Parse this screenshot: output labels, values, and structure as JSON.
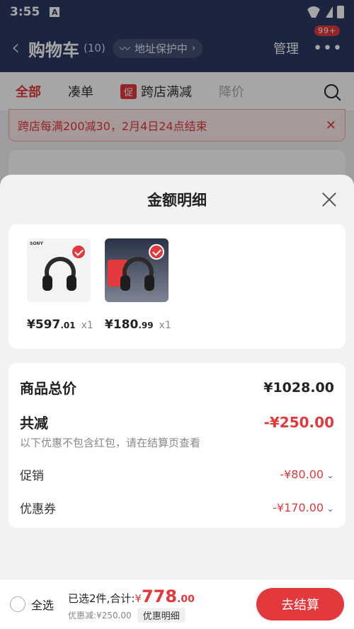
{
  "status": {
    "time": "3:55",
    "a_icon": "A"
  },
  "header": {
    "title": "购物车",
    "count": "(10)",
    "address_badge": "地址保护中",
    "manage": "管理",
    "badge": "99+"
  },
  "tabs": {
    "all": "全部",
    "combine": "凑单",
    "promo_badge": "促",
    "promo": "跨店满减",
    "price_drop": "降价"
  },
  "notice": {
    "text": "跨店每满200减30，2月4日24点结束"
  },
  "sheet": {
    "title": "金额明细",
    "products": [
      {
        "brand": "SONY",
        "price_int": "¥597",
        "price_dec": ".01",
        "qty": "x1"
      },
      {
        "price_int": "¥180",
        "price_dec": ".99",
        "qty": "x1"
      }
    ],
    "total_label": "商品总价",
    "total_value": "¥1028.00",
    "discount_label": "共减",
    "discount_value": "-¥250.00",
    "discount_note": "以下优惠不包含红包，请在结算页查看",
    "promo_label": "促销",
    "promo_value": "-¥80.00",
    "coupon_label": "优惠券",
    "coupon_value": "-¥170.00"
  },
  "footer": {
    "select_all": "全选",
    "selected": "已选2件,合计:",
    "currency": "¥",
    "amount_int": "778",
    "amount_dec": ".00",
    "saved": "优惠减:¥250.00",
    "detail_button": "优惠明细",
    "checkout": "去结算"
  },
  "colors": {
    "brand_red": "#e4393c",
    "header_bg": "#2b3a63"
  }
}
